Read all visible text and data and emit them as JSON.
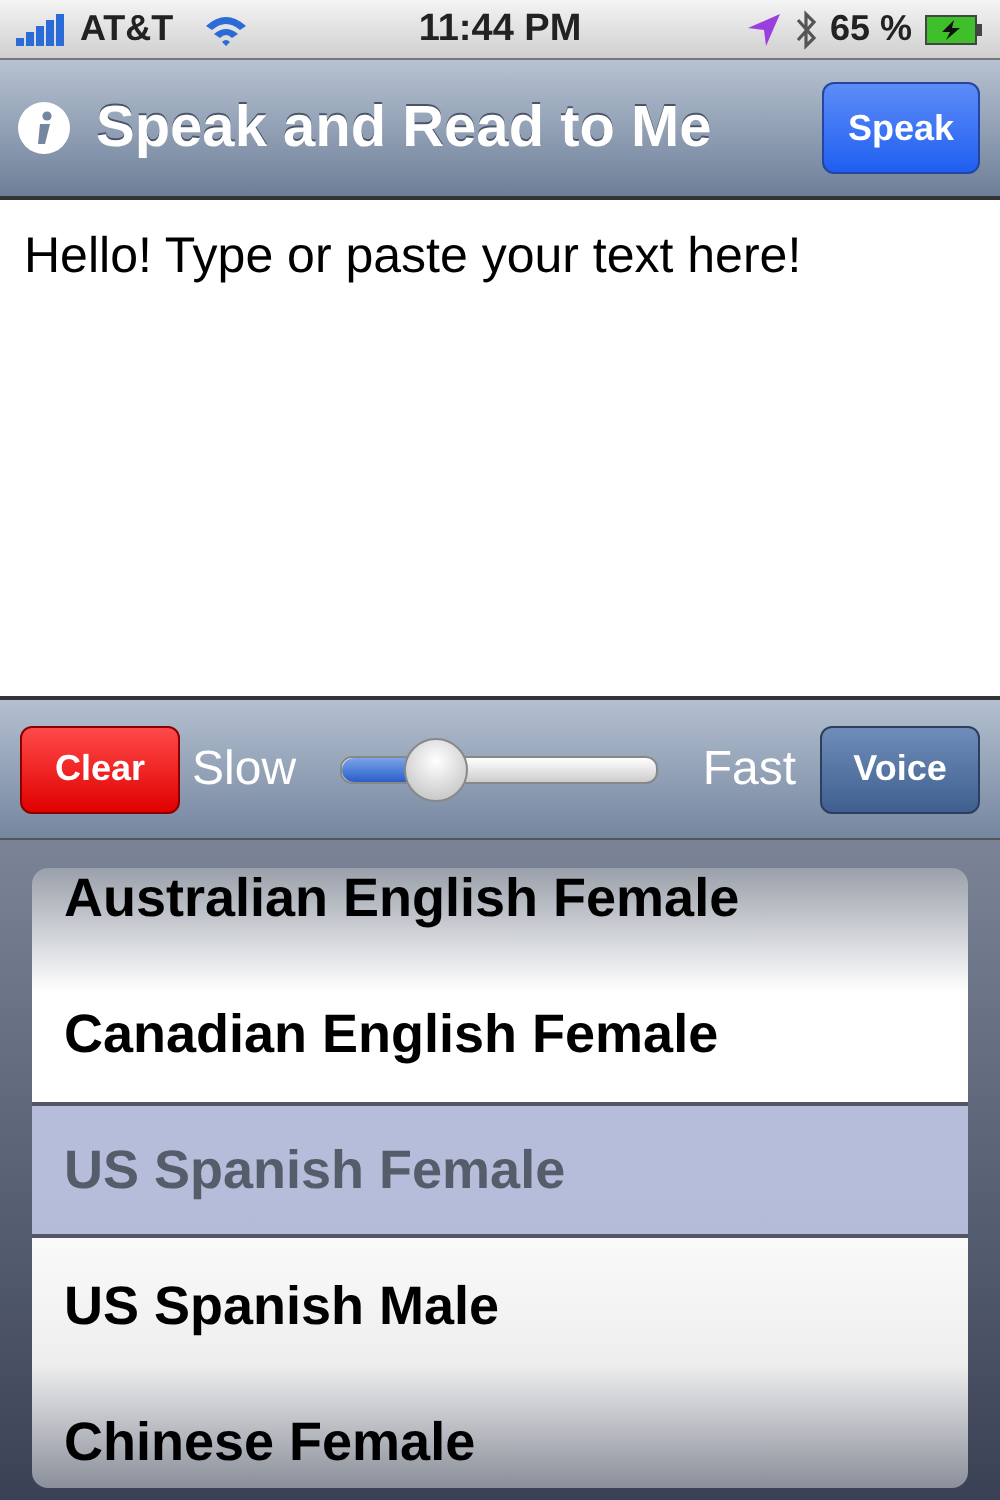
{
  "status_bar": {
    "carrier": "AT&T",
    "time": "11:44 PM",
    "battery_percent": "65 %"
  },
  "nav_bar": {
    "title": "Speak and Read to Me",
    "action": "Speak"
  },
  "text_area": {
    "value": "Hello! Type or paste your text here!"
  },
  "toolbar": {
    "clear": "Clear",
    "slow_label": "Slow",
    "fast_label": "Fast",
    "speed": {
      "level": 0.3
    },
    "voice": "Voice"
  },
  "voice_picker": [
    {
      "label": "Australian English Female",
      "selected": false
    },
    {
      "label": "Canadian English Female",
      "selected": false
    },
    {
      "label": "US Spanish Female",
      "selected": true
    },
    {
      "label": "US Spanish Male",
      "selected": false
    },
    {
      "label": "Chinese Female",
      "selected": false
    }
  ]
}
